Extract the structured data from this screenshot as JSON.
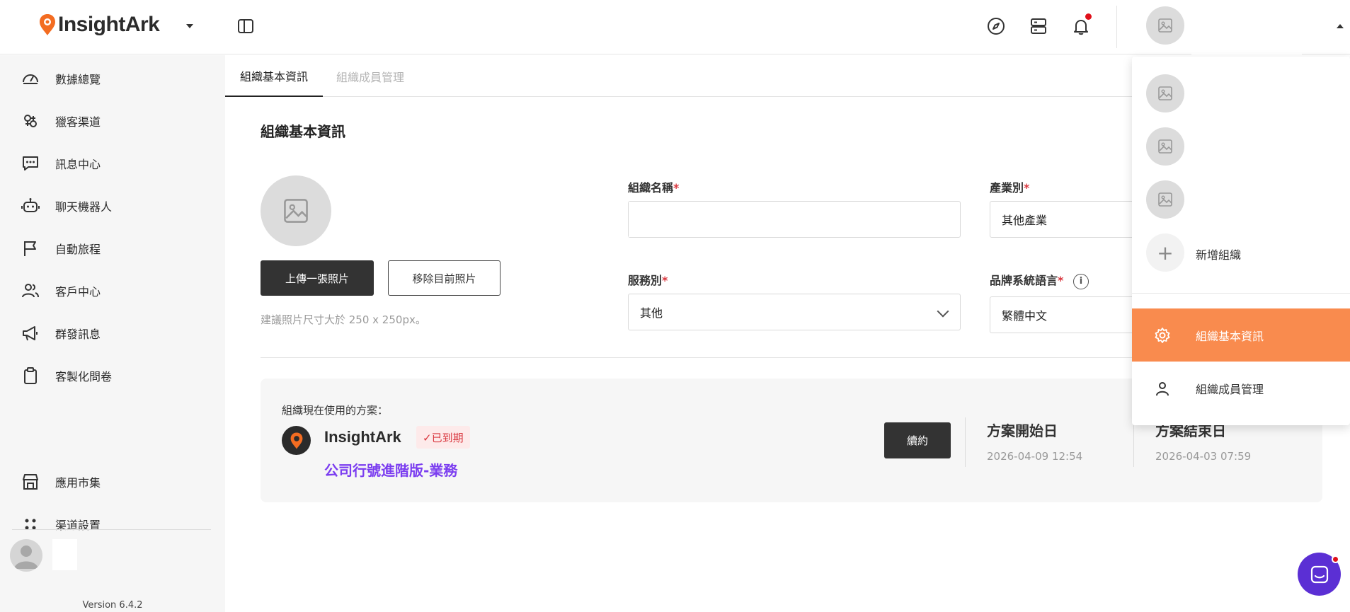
{
  "header": {
    "brand": "InsightArk",
    "icons": [
      "compass-icon",
      "server-icon",
      "bell-icon",
      "avatar-placeholder-icon"
    ]
  },
  "sidebar": {
    "items": [
      {
        "label": "數據總覽",
        "icon": "gauge-icon"
      },
      {
        "label": "獵客渠道",
        "icon": "channel-icon"
      },
      {
        "label": "訊息中心",
        "icon": "message-icon"
      },
      {
        "label": "聊天機器人",
        "icon": "robot-icon"
      },
      {
        "label": "自動旅程",
        "icon": "flag-icon"
      },
      {
        "label": "客戶中心",
        "icon": "users-icon"
      },
      {
        "label": "群發訊息",
        "icon": "megaphone-icon"
      },
      {
        "label": "客製化問卷",
        "icon": "clipboard-icon"
      }
    ],
    "bottom_items": [
      {
        "label": "應用市集",
        "icon": "store-icon"
      },
      {
        "label": "渠道設置",
        "icon": "dots-icon"
      }
    ],
    "version": "Version 6.4.2"
  },
  "tabs": [
    {
      "label": "組織基本資訊",
      "active": true
    },
    {
      "label": "組織成員管理",
      "active": false
    }
  ],
  "org_info": {
    "title": "組織基本資訊",
    "upload_button": "上傳一張照片",
    "remove_button": "移除目前照片",
    "photo_hint": "建議照片尺寸大於 250 x 250px。",
    "fields": {
      "org_name": {
        "label": "組織名稱",
        "required": "*",
        "value": ""
      },
      "industry": {
        "label": "產業別",
        "required": "*",
        "value": "其他產業"
      },
      "service": {
        "label": "服務別",
        "required": "*",
        "value": "其他"
      },
      "language": {
        "label": "品牌系統語言",
        "required": "*",
        "value": "繁體中文",
        "info": "i"
      }
    }
  },
  "plan": {
    "label": "組織現在使用的方案：",
    "name": "InsightArk",
    "status": "✓已到期",
    "tier": "公司行號進階版-業務",
    "renew_button": "續約",
    "start_title": "方案開始日",
    "start_date": "2026-04-09 12:54",
    "end_title": "方案結束日",
    "end_date": "2026-04-03 07:59"
  },
  "dropdown": {
    "add_org": "新增組織",
    "menu": [
      {
        "label": "組織基本資訊",
        "icon": "gear-icon",
        "active": true
      },
      {
        "label": "組織成員管理",
        "icon": "user-icon",
        "active": false
      }
    ]
  },
  "colors": {
    "accent": "#f98b4e",
    "dark_button": "#333333",
    "expired": "#d9363e",
    "tier": "#7b3df0",
    "chat": "#5b2fd4"
  }
}
